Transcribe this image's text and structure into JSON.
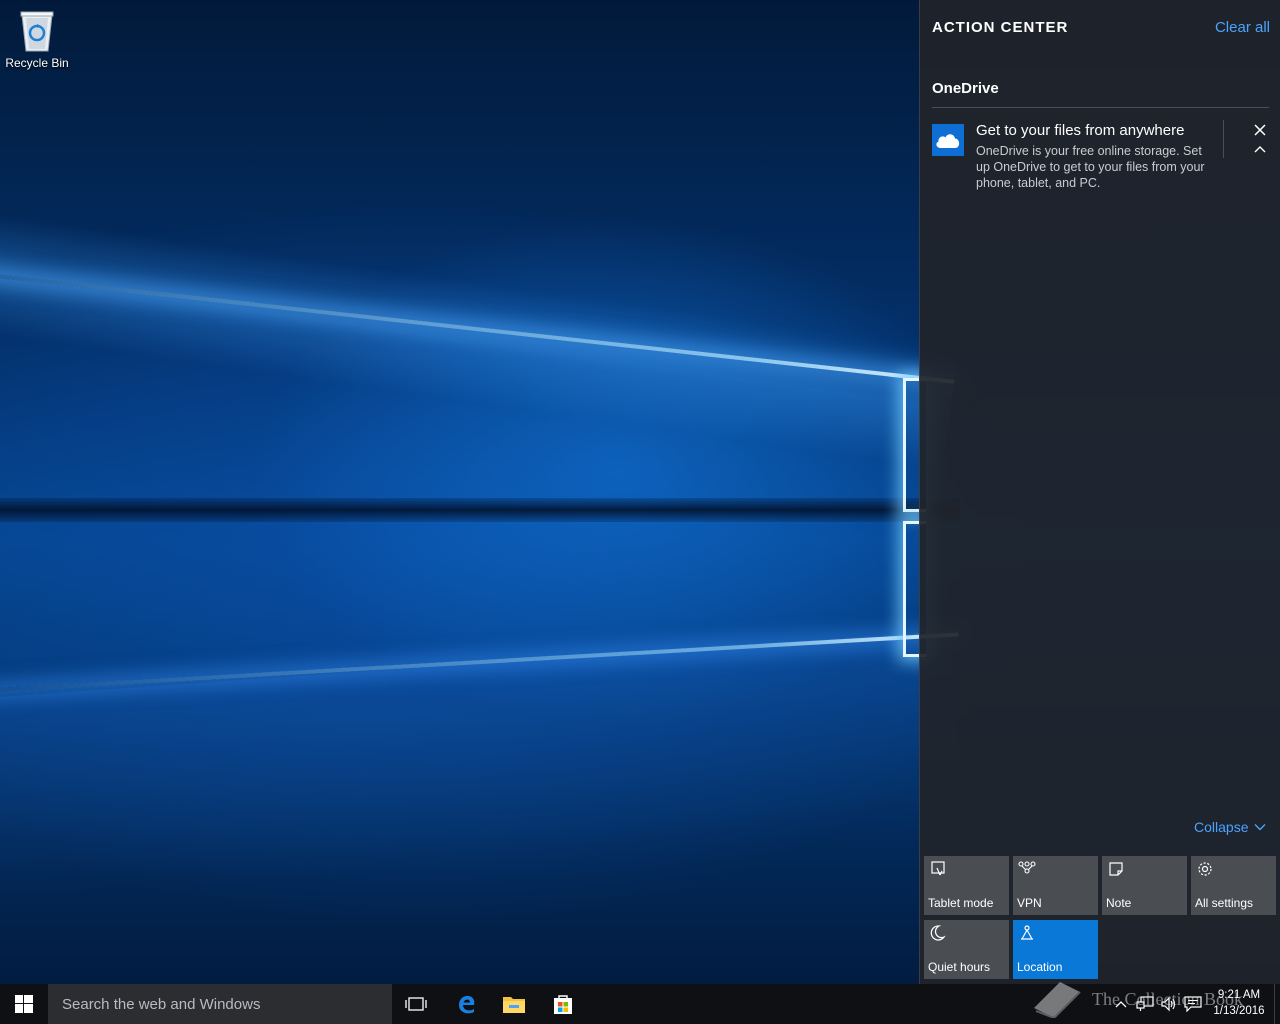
{
  "desktop": {
    "icons": [
      {
        "label": "Recycle Bin",
        "icon": "recycle-bin-icon"
      }
    ]
  },
  "action_center": {
    "title": "ACTION CENTER",
    "clear_all": "Clear all",
    "groups": [
      {
        "app": "OneDrive",
        "icon": "cloud-icon",
        "notifications": [
          {
            "title": "Get to your files from anywhere",
            "body": "OneDrive is your free online storage. Set up OneDrive to get to your files from your phone, tablet, and PC."
          }
        ]
      }
    ],
    "collapse": "Collapse",
    "quick_actions": [
      {
        "label": "Tablet mode",
        "icon": "tablet-mode-icon",
        "on": false
      },
      {
        "label": "VPN",
        "icon": "vpn-icon",
        "on": false
      },
      {
        "label": "Note",
        "icon": "note-icon",
        "on": false
      },
      {
        "label": "All settings",
        "icon": "gear-icon",
        "on": false
      },
      {
        "label": "Quiet hours",
        "icon": "moon-icon",
        "on": false
      },
      {
        "label": "Location",
        "icon": "location-icon",
        "on": true
      }
    ]
  },
  "taskbar": {
    "search_placeholder": "Search the web and Windows",
    "pinned": [
      "task-view-icon",
      "edge-icon",
      "file-explorer-icon",
      "store-icon"
    ],
    "tray": [
      "chevron-up-icon",
      "network-icon",
      "volume-icon",
      "action-center-icon"
    ],
    "clock": {
      "time": "9:21 AM",
      "date": "1/13/2016"
    }
  },
  "watermark": {
    "text": "The Collection Book"
  },
  "colors": {
    "accent": "#0a78d7",
    "link": "#4aa3ff",
    "panel": "#202428",
    "tile": "#4a4d52"
  }
}
